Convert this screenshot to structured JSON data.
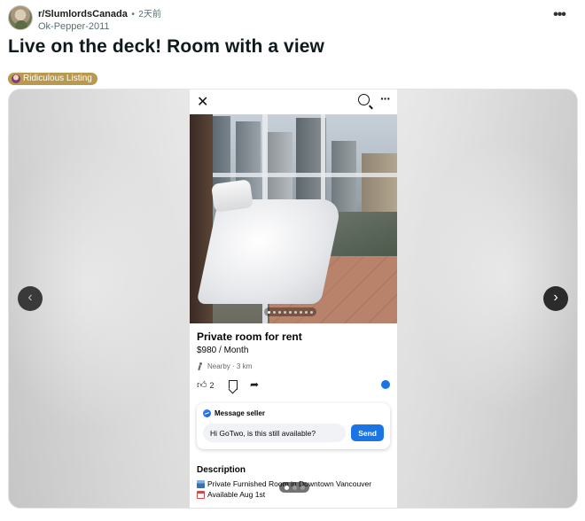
{
  "header": {
    "subreddit": "r/SlumlordsCanada",
    "separator": "•",
    "time_ago": "2天前",
    "author": "Ok-Pepper-2011",
    "more_icon": "more-horizontal-icon"
  },
  "post": {
    "title": "Live on the deck! Room with a view",
    "flair": "Ridiculous Listing"
  },
  "gallery": {
    "prev_icon": "‹",
    "next_icon": "›",
    "current_index": 1,
    "total_images": 3
  },
  "screenshot": {
    "close_icon": "✕",
    "more_icon": "···",
    "photo_count": 9,
    "photo_active_index": 1,
    "listing": {
      "title": "Private room for rent",
      "price": "$980 / Month",
      "location": "Nearby · 3 km",
      "like_count": "2"
    },
    "message": {
      "header": "Message seller",
      "input_value": "Hi GoTwo, is this still available?",
      "send_label": "Send"
    },
    "description": {
      "title": "Description",
      "line1": "Private Furnished Room in Downtown Vancouver",
      "line2": "Available Aug 1st"
    }
  },
  "colors": {
    "flair_bg": "#b9994e",
    "facebook_blue": "#1b74e4"
  }
}
